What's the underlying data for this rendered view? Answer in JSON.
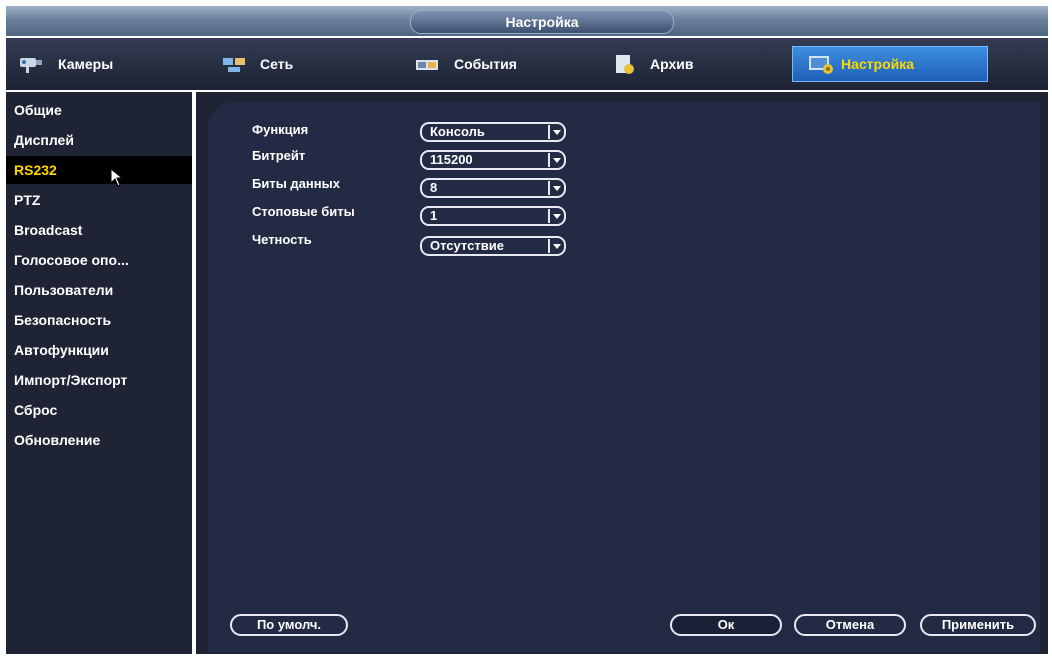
{
  "window": {
    "title": "Настройка"
  },
  "tabs": [
    {
      "label": "Камеры",
      "icon": "camera-icon"
    },
    {
      "label": "Сеть",
      "icon": "network-icon"
    },
    {
      "label": "События",
      "icon": "events-icon"
    },
    {
      "label": "Архив",
      "icon": "archive-icon"
    },
    {
      "label": "Настройка",
      "icon": "settings-icon"
    }
  ],
  "sidebar": {
    "items": [
      {
        "label": "Общие"
      },
      {
        "label": "Дисплей"
      },
      {
        "label": "RS232"
      },
      {
        "label": "PTZ"
      },
      {
        "label": "Broadcast"
      },
      {
        "label": "Голосовое опо..."
      },
      {
        "label": "Пользователи"
      },
      {
        "label": "Безопасность"
      },
      {
        "label": "Автофункции"
      },
      {
        "label": "Импорт/Экспорт"
      },
      {
        "label": "Сброс"
      },
      {
        "label": "Обновление"
      }
    ]
  },
  "form": {
    "function_label": "Функция",
    "function_value": "Консоль",
    "baud_label": "Битрейт",
    "baud_value": "115200",
    "databits_label": "Биты данных",
    "databits_value": "8",
    "stopbits_label": "Стоповые биты",
    "stopbits_value": "1",
    "parity_label": "Четность",
    "parity_value": "Отсутствие"
  },
  "buttons": {
    "default": "По умолч.",
    "ok": "Ок",
    "cancel": "Отмена",
    "apply": "Применить"
  },
  "colors": {
    "active_text": "#ffd700",
    "panel_bg": "#232b44",
    "frame_bg": "#1f2434"
  }
}
